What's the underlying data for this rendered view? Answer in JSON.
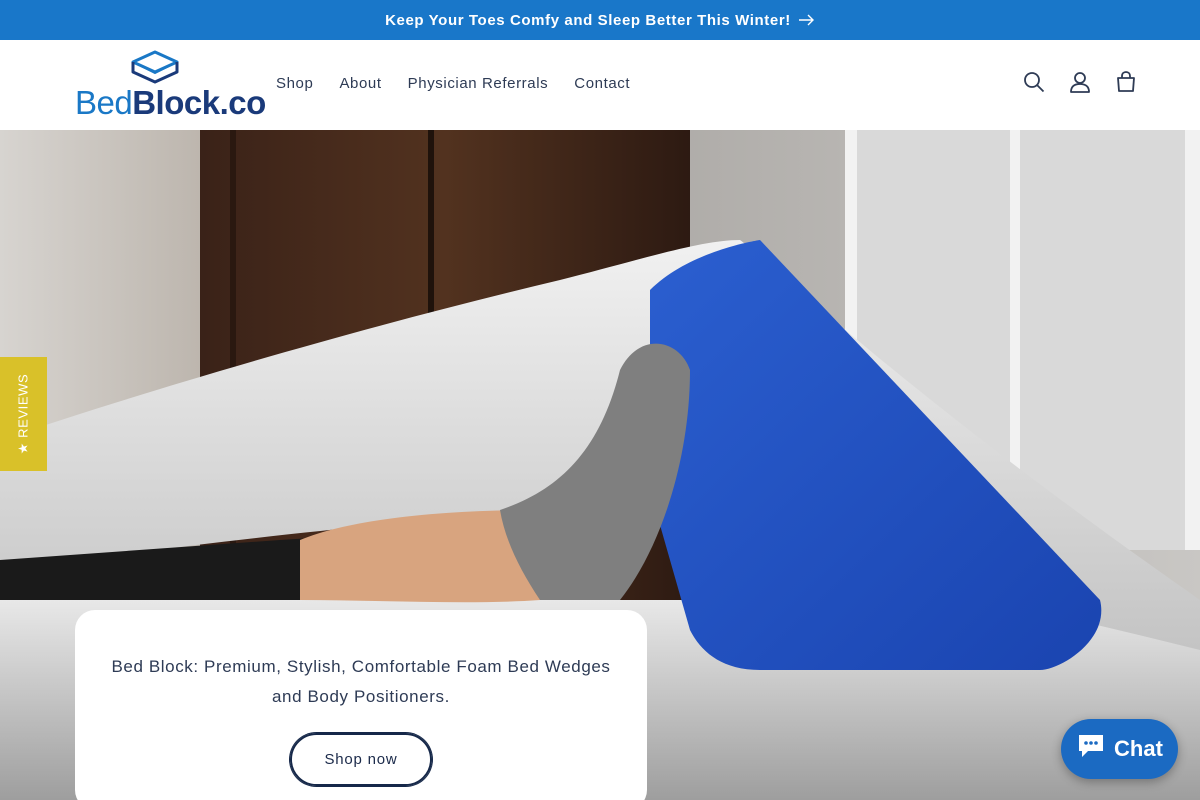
{
  "announcement": {
    "text": "Keep Your Toes Comfy and Sleep Better This Winter!",
    "icon": "arrow-right-icon"
  },
  "logo": {
    "part1": "Bed",
    "part2": "Block.co",
    "icon": "book-logo-icon"
  },
  "nav": {
    "items": [
      "Shop",
      "About",
      "Physician Referrals",
      "Contact"
    ]
  },
  "header_icons": [
    "search-icon",
    "account-icon",
    "cart-icon"
  ],
  "reviews_tab": {
    "label": "★ REVIEWS"
  },
  "hero": {
    "headline": "Bed Block: Premium, Stylish, Comfortable Foam Bed Wedges and Body Positioners.",
    "button_label": "Shop now"
  },
  "chat": {
    "label": "Chat",
    "icon": "chat-bubble-icon"
  },
  "colors": {
    "announce_bg": "#1977c9",
    "reviews_tab": "#d9c129",
    "chat_bg": "#1b6ac2",
    "wedge": "#1f4fbf"
  }
}
